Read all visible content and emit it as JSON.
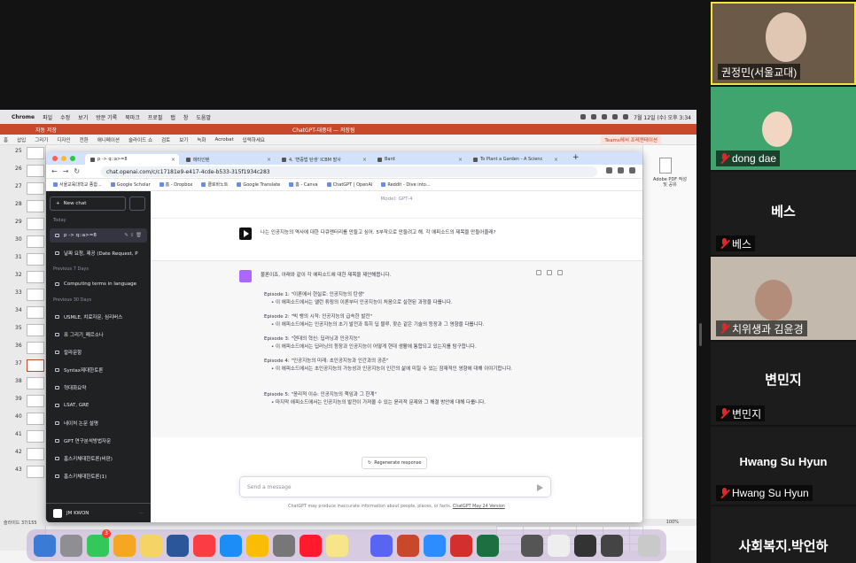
{
  "mac_menu": {
    "apple": "",
    "items": [
      "Chrome",
      "파일",
      "수정",
      "보기",
      "방문 기록",
      "북마크",
      "프로필",
      "탭",
      "창",
      "도움말"
    ],
    "datetime": "7월 12일 (수) 오후 3:34"
  },
  "ppt": {
    "title_left": "자동 저장",
    "title_center": "ChatGPT-대중대 — 저장됨",
    "ribbon": [
      "홈",
      "삽입",
      "그리기",
      "디자인",
      "전환",
      "애니메이션",
      "슬라이드 쇼",
      "검토",
      "보기",
      "녹화",
      "Acrobat",
      "입력하세요"
    ],
    "teams": "Teams에서 프레젠테이션",
    "slide_numbers": [
      "25",
      "26",
      "27",
      "28",
      "29",
      "30",
      "31",
      "32",
      "33",
      "34",
      "35",
      "36",
      "37",
      "38",
      "39",
      "40",
      "41",
      "42",
      "43"
    ],
    "pdf_label": "Adobe PDF 작성 및 공유",
    "status_left": "슬라이드 37/155",
    "zoom": "100%"
  },
  "chrome": {
    "tabs": [
      "p -> q::a>=8",
      "메타인텐",
      "4, '변증법 탄생' ICBM 발사",
      "Bard",
      "To Plant a Garden - A Scienc"
    ],
    "url": "chat.openai.com/c/c17181e9-e417-4cde-b533-315f1934c283",
    "bookmarks": [
      "서울교육대학교 종합...",
      "Google Scholar",
      "홈 - Dropbox",
      "클로바노트",
      "Google Translate",
      "홈 - Canva",
      "ChatGPT | OpenAI",
      "Reddit - Dive into..."
    ]
  },
  "gpt": {
    "new_chat": "New chat",
    "sections": {
      "today": "Today",
      "prev7": "Previous 7 Days",
      "prev30": "Previous 30 Days"
    },
    "today_items": [
      "p -> q::a>=8",
      "날짜 요청, 제공 (Date Request, P"
    ],
    "prev7_items": [
      "Computing terms in language"
    ],
    "prev30_items": [
      "USMLE, 치료자문, 심리버스",
      "표 그리기_폐르소나",
      "칼라문항",
      "Syntax제대한토론",
      "혁대화요약",
      "LSAT, GRE",
      "네이처 논문 설명",
      "GPT 연구분석방법자문",
      "홈스키체대한토론(비판)",
      "홈스키체대한토론(1)"
    ],
    "account": "JM KWON",
    "model": "Model: GPT-4",
    "user_msg": "나는 인공지능의 역사에 대한 다큐멘터리를 만들고 싶어. 5부작으로 만들려고 해. 각 에피소드의 제목을 만들어줄래?",
    "asst_intro": "물론이죠, 아래와 같이 각 에피소드에 대한 제목을 제안해봅니다.",
    "episodes": [
      {
        "title": "Episode 1: \"이론에서 현실로: 인공지능의 탄생\"",
        "desc": "이 에피소드에서는 앨런 튜링의 이론부터 인공지능이 처음으로 실현된 과정을 다룹니다."
      },
      {
        "title": "Episode 2: \"빅 뱅의 시작: 인공지능의 급속한 발전\"",
        "desc": "이 에피소드에서는 인공지능의 초기 발전과 특히 딥 블루, 왓슨 같은 기술의 등장과 그 영향을 다룹니다."
      },
      {
        "title": "Episode 3: \"현대의 혁신: 딥러닝과 인공지능\"",
        "desc": "이 에피소드에서는 딥러닝의 등장과 인공지능이 어떻게 현대 생활에 통합되고 있는지를 탐구합니다."
      },
      {
        "title": "Episode 4: \"인공지능의 미래: 초인공지능과 인간과의 공존\"",
        "desc": "이 에피소드에서는 초인공지능의 가능성과 인공지능이 인간의 삶에 미칠 수 있는 잠재적인 영향에 대해 이야기합니다."
      },
      {
        "title": "Episode 5: \"윤리적 이슈: 인공지능의 책임과 그 한계\"",
        "desc": "마지막 에피소드에서는 인공지능의 발전이 가져올 수 있는 윤리적 문제와 그 해결 방안에 대해 다룹니다."
      }
    ],
    "regenerate": "Regenerate response",
    "input_placeholder": "Send a message",
    "disclaimer": "ChatGPT may produce inaccurate information about people, places, or facts.",
    "disclaimer_link": "ChatGPT May 24 Version"
  },
  "dock_badge": "3",
  "participants": [
    {
      "name": "권정민(서울교대)",
      "muted": false
    },
    {
      "name": "dong dae",
      "muted": true
    },
    {
      "name": "베스",
      "muted": true,
      "big": "베스"
    },
    {
      "name": "치위생과 김윤경",
      "muted": true
    },
    {
      "name": "변민지",
      "muted": true,
      "big": "변민지"
    },
    {
      "name": "Hwang Su Hyun",
      "muted": true,
      "big": "Hwang Su Hyun"
    },
    {
      "big": "사회복지.박언하"
    }
  ],
  "colors": {
    "gpt_sidebar": "#202123",
    "ppt_accent": "#c7482a",
    "active_speaker": "#f5e23a",
    "mute": "#e02828"
  }
}
